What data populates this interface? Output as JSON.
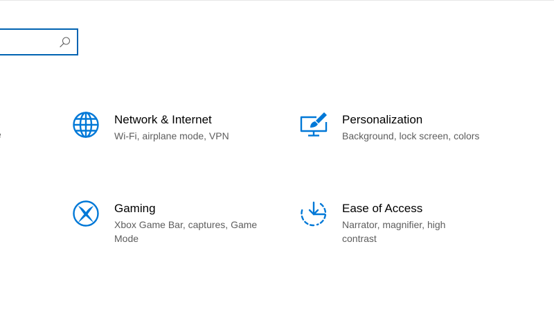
{
  "search": {
    "value": "",
    "placeholder": ""
  },
  "clipped_item": {
    "text": "e"
  },
  "tiles": [
    {
      "title": "Network & Internet",
      "description": "Wi-Fi, airplane mode, VPN",
      "icon": "globe-icon"
    },
    {
      "title": "Personalization",
      "description": "Background, lock screen, colors",
      "icon": "paintbrush-monitor-icon"
    },
    {
      "title": "Gaming",
      "description": "Xbox Game Bar, captures, Game Mode",
      "icon": "xbox-icon"
    },
    {
      "title": "Ease of Access",
      "description": "Narrator, magnifier, high contrast",
      "icon": "ease-of-access-icon"
    }
  ],
  "colors": {
    "accent": "#0063b1",
    "icon_blue": "#0078d7",
    "title_text": "#000000",
    "description_text": "#5d5d5d",
    "background": "#ffffff"
  }
}
